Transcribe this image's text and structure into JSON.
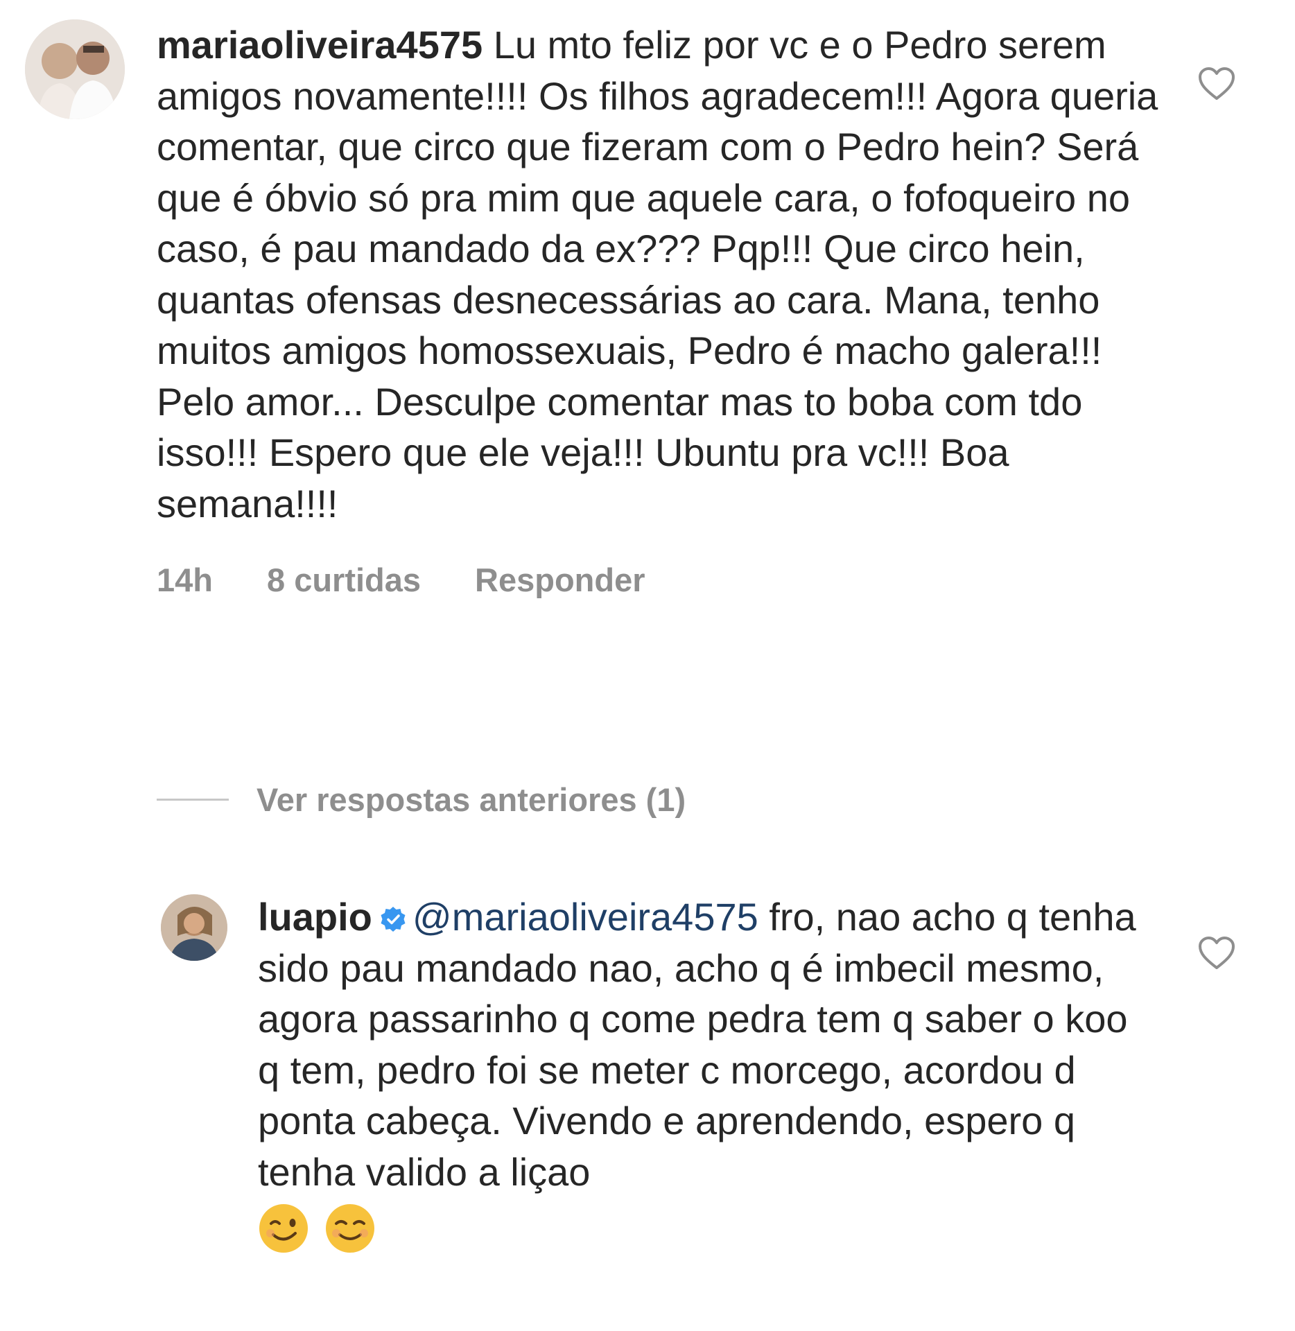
{
  "comments": [
    {
      "username": "mariaoliveira4575",
      "text": "Lu mto feliz por vc e o Pedro serem amigos novamente!!!! Os filhos agradecem!!! Agora queria comentar, que circo que fizeram com o Pedro hein? Será que é óbvio só pra mim que aquele cara, o fofoqueiro no caso, é pau mandado da ex??? Pqp!!! Que circo hein, quantas ofensas desnecessárias ao cara. Mana, tenho muitos amigos homossexuais, Pedro é macho galera!!! Pelo amor... Desculpe comentar mas to boba com tdo isso!!! Espero que ele veja!!! Ubuntu pra vc!!! Boa semana!!!!",
      "time": "14h",
      "likes": "8 curtidas",
      "reply_label": "Responder"
    }
  ],
  "view_replies": "Ver respostas anteriores (1)",
  "reply": {
    "username": "luapio",
    "verified": true,
    "mention": "@mariaoliveira4575",
    "text": "fro, nao acho q tenha sido pau mandado nao, acho q é imbecil mesmo, agora passarinho q come pedra tem q saber o koo q tem, pedro foi se meter c morcego, acordou d ponta cabeça. Vivendo e aprendendo, espero q tenha valido a liçao",
    "emojis": [
      "winking-face",
      "smiling-face"
    ]
  },
  "colors": {
    "text": "#262626",
    "secondary": "#8e8e8e",
    "mention": "#1f3f66",
    "verified": "#3897f0"
  }
}
